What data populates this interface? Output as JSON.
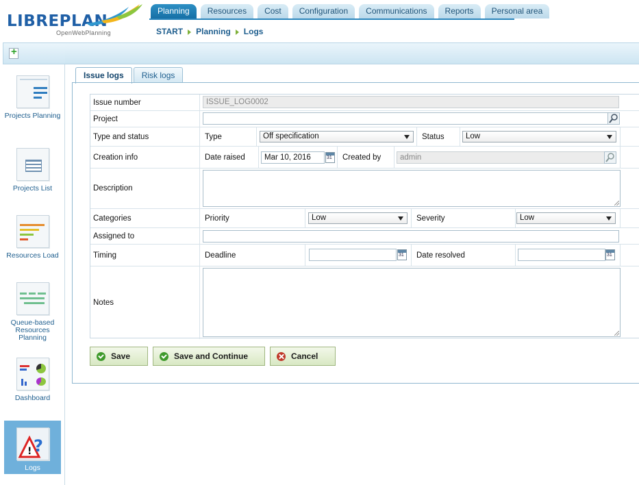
{
  "app": {
    "logo_text": "LIBREPLAN",
    "tagline": "OpenWebPlanning"
  },
  "nav": {
    "tabs": [
      {
        "label": "Planning",
        "active": true
      },
      {
        "label": "Resources"
      },
      {
        "label": "Cost"
      },
      {
        "label": "Configuration"
      },
      {
        "label": "Communications"
      },
      {
        "label": "Reports"
      },
      {
        "label": "Personal area"
      }
    ]
  },
  "breadcrumb": [
    "START",
    "Planning",
    "Logs"
  ],
  "sidebar": {
    "items": [
      {
        "label": "Projects Planning"
      },
      {
        "label": "Projects List"
      },
      {
        "label": "Resources Load"
      },
      {
        "label": "Queue-based Resources Planning"
      },
      {
        "label": "Dashboard"
      },
      {
        "label": "Logs",
        "active": true
      }
    ]
  },
  "content_tabs": [
    {
      "label": "Issue logs",
      "active": true
    },
    {
      "label": "Risk logs"
    }
  ],
  "form": {
    "issue_number": {
      "label": "Issue number",
      "value": "ISSUE_LOG0002"
    },
    "project": {
      "label": "Project",
      "value": ""
    },
    "type_status": {
      "label": "Type and status",
      "type_label": "Type",
      "type_value": "Off specification",
      "status_label": "Status",
      "status_value": "Low"
    },
    "creation": {
      "label": "Creation info",
      "date_label": "Date raised",
      "date_value": "Mar 10, 2016",
      "by_label": "Created by",
      "by_value": "admin"
    },
    "description": {
      "label": "Description",
      "value": ""
    },
    "categories": {
      "label": "Categories",
      "priority_label": "Priority",
      "priority_value": "Low",
      "severity_label": "Severity",
      "severity_value": "Low"
    },
    "assigned": {
      "label": "Assigned to",
      "value": ""
    },
    "timing": {
      "label": "Timing",
      "deadline_label": "Deadline",
      "deadline_value": "",
      "resolved_label": "Date resolved",
      "resolved_value": ""
    },
    "notes": {
      "label": "Notes",
      "value": ""
    }
  },
  "buttons": {
    "save": "Save",
    "save_continue": "Save and Continue",
    "cancel": "Cancel"
  },
  "colors": {
    "nav_active": "#1670a6",
    "link": "#1e5e8e",
    "button_bg": "#d8e8c3"
  }
}
